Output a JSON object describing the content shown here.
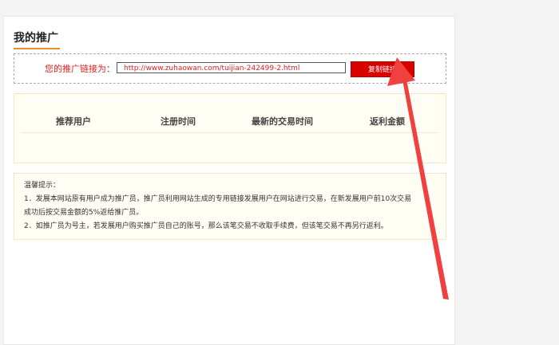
{
  "page": {
    "title": "我的推广"
  },
  "referral": {
    "label": "您的推广链接为：",
    "link": "http://www.zuhaowan.com/tuijian-242499-2.html",
    "copy_button": "复制链接"
  },
  "table": {
    "headers": [
      "推荐用户",
      "注册时间",
      "最新的交易时间",
      "返利金额"
    ],
    "rows": []
  },
  "tips": {
    "title": "温馨提示：",
    "lines": [
      "1．发展本网站原有用户成为推广员，推广员利用网站生成的专用链接发展用户在网站进行交易，在新发展用户前10次交易",
      "成功后按交易金额的5%返给推广员。",
      "2．如推广员为号主，若发展用户购买推广员自己的账号，那么该笔交易不收取手续费，但该笔交易不再另行返利。"
    ]
  },
  "annotation": {
    "arrow_color": "#f04040",
    "type": "pointer-arrow"
  }
}
